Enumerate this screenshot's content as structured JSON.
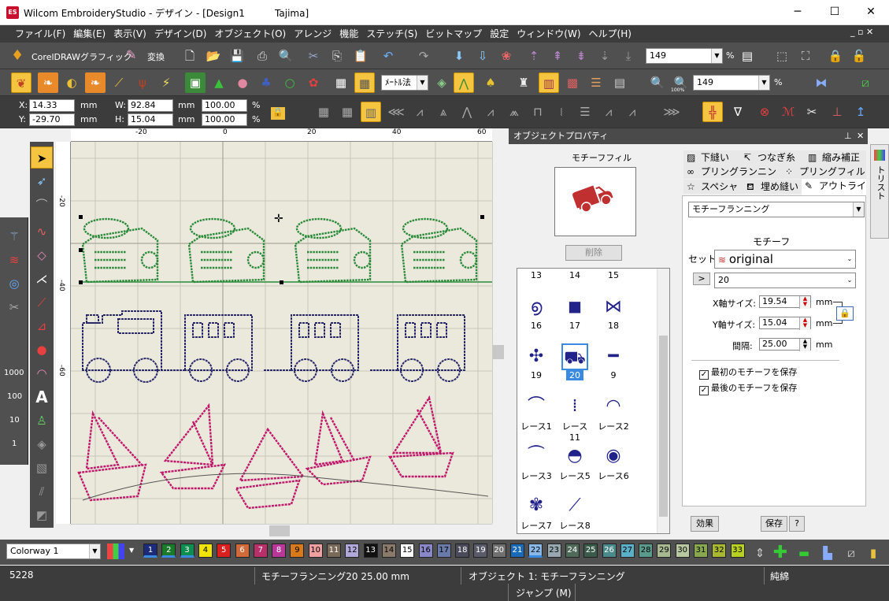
{
  "title_bar": {
    "app_title": "Wilcom EmbroideryStudio - デザイン - [Design1",
    "machine": "Tajima]",
    "logo_text": "ES",
    "minimize": "─",
    "maximize": "☐",
    "close": "✕"
  },
  "menu": {
    "items": [
      "ファイル(F)",
      "編集(E)",
      "表示(V)",
      "デザイン(D)",
      "オブジェクト(O)",
      "アレンジ",
      "機能",
      "ステッチ(S)",
      "ビットマップ",
      "設定",
      "ウィンドウ(W)",
      "ヘルプ(H)"
    ],
    "mdi_controls": "_ ▫ ✕"
  },
  "toolbar1": {
    "coreldraw_label": "CorelDRAWグラフィック",
    "convert_label": "変換",
    "zoom_value": "149",
    "zoom_unit": "%"
  },
  "toolbar2": {
    "method_select": "ﾒｰﾄﾙ法",
    "zoom_value": "149",
    "zoom_unit": "%",
    "zoom_percent_label": "100%"
  },
  "property_bar": {
    "x_label": "X:",
    "x_value": "14.33",
    "x_unit": "mm",
    "y_label": "Y:",
    "y_value": "-29.70",
    "y_unit": "mm",
    "w_label": "W:",
    "w_value": "92.84",
    "w_unit": "mm",
    "h_label": "H:",
    "h_value": "15.04",
    "h_unit": "mm",
    "w_pct": "100.00",
    "h_pct": "100.00",
    "pct_unit": "%"
  },
  "rulers": {
    "top_ticks": [
      "-20",
      "0",
      "20",
      "40",
      "60"
    ],
    "left_ticks": [
      "-20",
      "-40",
      "-60"
    ]
  },
  "left_flyout": {
    "labels": [
      "1000",
      "100",
      "10",
      "1"
    ]
  },
  "panel": {
    "title": "オブジェクトプロパティ",
    "pin": "⊥",
    "close": "✕",
    "preview_label": "モチーフフィル",
    "delete_button": "削除",
    "side_tab_label": "カラーオブジェクトリスト",
    "tabs_row1": [
      "下縫い",
      "つなぎ糸",
      "縮み補正"
    ],
    "tabs_row2": [
      "プリングランニング",
      "プリングフィル"
    ],
    "tabs_row3": [
      "スペシャル",
      "埋め縫い",
      "アウトライン"
    ],
    "type_select": "モチーフランニング",
    "motif_heading": "モチーフ",
    "set_label": "セット:",
    "set_value": "original",
    "number_value": "20",
    "x_size_label": "X軸サイズ:",
    "x_size_value": "19.54",
    "y_size_label": "Y軸サイズ:",
    "y_size_value": "15.04",
    "spacing_label": "間隔:",
    "spacing_value": "25.00",
    "unit": "mm",
    "keep_first": "最初のモチーフを保存",
    "keep_last": "最後のモチーフを保存",
    "effects_button": "効果",
    "save_button": "保存",
    "help_button": "?"
  },
  "motifs": [
    {
      "label": "13",
      "icon": "none"
    },
    {
      "label": "14",
      "icon": "none"
    },
    {
      "label": "15",
      "icon": "none"
    },
    {
      "label": "16",
      "icon": "swirl-motif"
    },
    {
      "label": "17",
      "icon": "squares-motif"
    },
    {
      "label": "18",
      "icon": "bow-motif"
    },
    {
      "label": "19",
      "icon": "pinwheel-motif"
    },
    {
      "label": "20",
      "icon": "train-motif"
    },
    {
      "label": "9",
      "icon": "bone-motif"
    },
    {
      "label": "レース1",
      "icon": "lace-arch-motif"
    },
    {
      "label": "レース11",
      "icon": "lace-dots-motif"
    },
    {
      "label": "レース2",
      "icon": "lace-arc-motif"
    },
    {
      "label": "レース3",
      "icon": "lace-fan-motif"
    },
    {
      "label": "レース5",
      "icon": "lace-scallop-motif"
    },
    {
      "label": "レース6",
      "icon": "lace-dome-motif"
    },
    {
      "label": "レース7",
      "icon": "lace-flower-motif"
    },
    {
      "label": "レース8",
      "icon": "lace-line-motif"
    }
  ],
  "colorbar": {
    "colorway": "Colorway 1",
    "swatches": [
      {
        "n": "1",
        "c": "#1c2a7a"
      },
      {
        "n": "2",
        "c": "#1a7a2a"
      },
      {
        "n": "3",
        "c": "#0f8f4f"
      },
      {
        "n": "4",
        "c": "#f2e600"
      },
      {
        "n": "5",
        "c": "#d82020"
      },
      {
        "n": "6",
        "c": "#d06a3a"
      },
      {
        "n": "7",
        "c": "#b8306a"
      },
      {
        "n": "8",
        "c": "#b8389a"
      },
      {
        "n": "9",
        "c": "#d97a1a"
      },
      {
        "n": "10",
        "c": "#f0a0a0"
      },
      {
        "n": "11",
        "c": "#7a6a5a"
      },
      {
        "n": "12",
        "c": "#b0a8d8"
      },
      {
        "n": "13",
        "c": "#111111"
      },
      {
        "n": "14",
        "c": "#8a7a6a"
      },
      {
        "n": "15",
        "c": "#ffffff"
      },
      {
        "n": "16",
        "c": "#8a88c8"
      },
      {
        "n": "17",
        "c": "#6a7aa8"
      },
      {
        "n": "18",
        "c": "#4a4a5a"
      },
      {
        "n": "19",
        "c": "#5a5a6a"
      },
      {
        "n": "20",
        "c": "#707070"
      },
      {
        "n": "21",
        "c": "#1a6ab8"
      },
      {
        "n": "22",
        "c": "#8ab8e8"
      },
      {
        "n": "23",
        "c": "#98a8b0"
      },
      {
        "n": "24",
        "c": "#506a5a"
      },
      {
        "n": "25",
        "c": "#3a5a4a"
      },
      {
        "n": "26",
        "c": "#4a8a8a"
      },
      {
        "n": "27",
        "c": "#5ab0c8"
      },
      {
        "n": "28",
        "c": "#5a9a8a"
      },
      {
        "n": "29",
        "c": "#a8b890"
      },
      {
        "n": "30",
        "c": "#b8c8a0"
      },
      {
        "n": "31",
        "c": "#88a850"
      },
      {
        "n": "32",
        "c": "#a8b830"
      },
      {
        "n": "33",
        "c": "#b8d020"
      }
    ]
  },
  "status": {
    "stitch_count": "5228",
    "stitch_info": "モチーフランニング20  25.00 mm",
    "object_info": "オブジェクト 1: モチーフランニング",
    "thread": "純綿",
    "jump": "ジャンプ (M)"
  },
  "colors": {
    "accent": "#f5c542",
    "green_stitch": "#2a8a3a",
    "blue_stitch": "#2a2a6a",
    "pink_stitch": "#c0186a",
    "selection": "#3a8ae0"
  }
}
